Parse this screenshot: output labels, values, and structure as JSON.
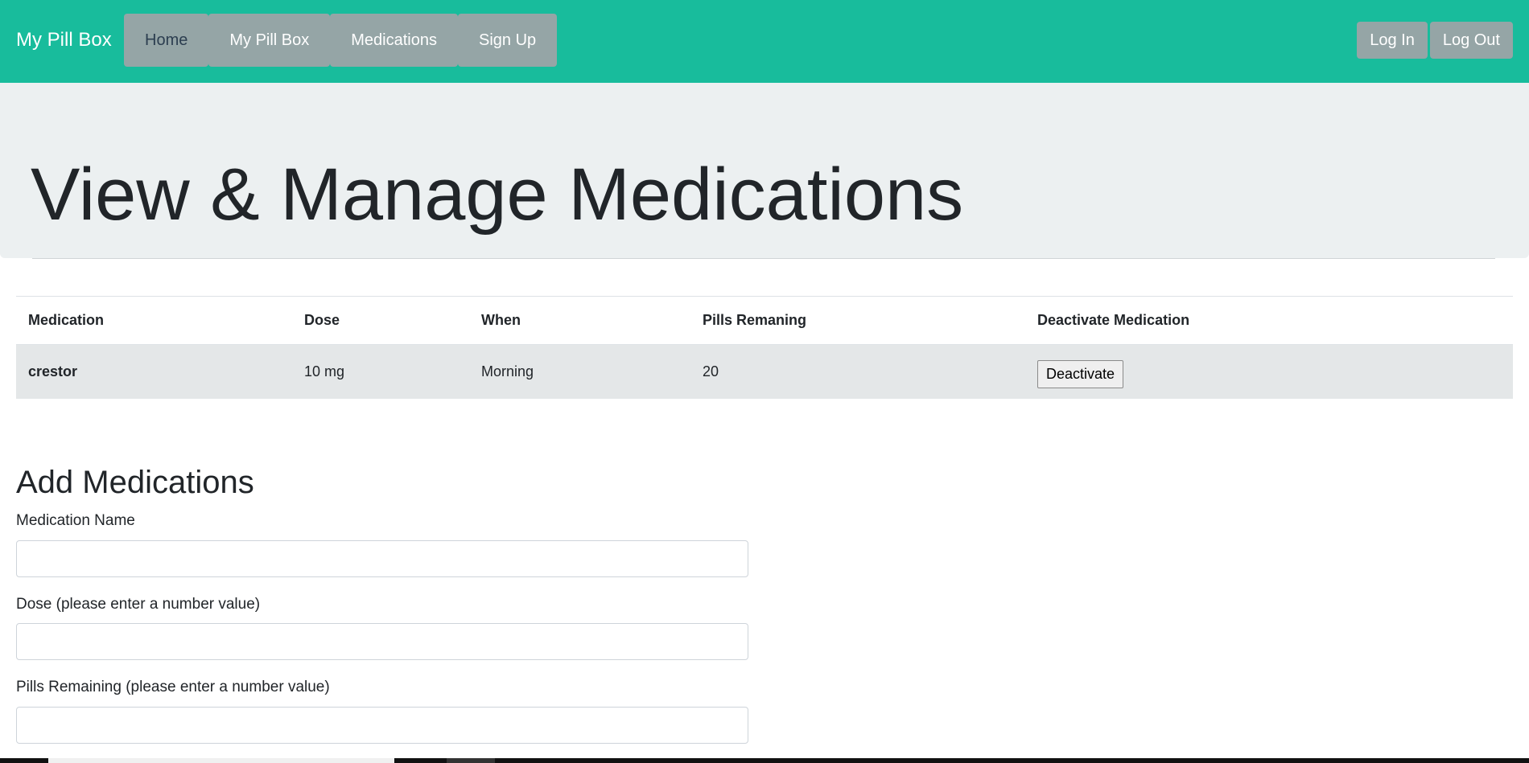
{
  "navbar": {
    "brand": "My Pill Box",
    "tabs": [
      {
        "label": "Home",
        "active": true
      },
      {
        "label": "My Pill Box",
        "active": false
      },
      {
        "label": "Medications",
        "active": false
      },
      {
        "label": "Sign Up",
        "active": false
      }
    ],
    "right": {
      "login_label": "Log In",
      "logout_label": "Log Out"
    }
  },
  "jumbotron": {
    "title": "View & Manage Medications"
  },
  "table": {
    "headers": [
      "Medication",
      "Dose",
      "When",
      "Pills Remaning",
      "Deactivate Medication"
    ],
    "rows": [
      {
        "medication": "crestor",
        "dose": "10 mg",
        "when": "Morning",
        "pills_remaining": "20",
        "action_label": "Deactivate"
      }
    ]
  },
  "form": {
    "title": "Add Medications",
    "fields": [
      {
        "label": "Medication Name",
        "value": "",
        "placeholder": ""
      },
      {
        "label": "Dose (please enter a number value)",
        "value": "",
        "placeholder": ""
      },
      {
        "label": "Pills Remaining (please enter a number value)",
        "value": "",
        "placeholder": ""
      }
    ]
  },
  "colors": {
    "navbar_bg": "#18bc9c",
    "nav_button_bg": "#95a5a6",
    "jumbotron_bg": "#ecf0f1",
    "table_row_bg": "#e4e7e8"
  }
}
